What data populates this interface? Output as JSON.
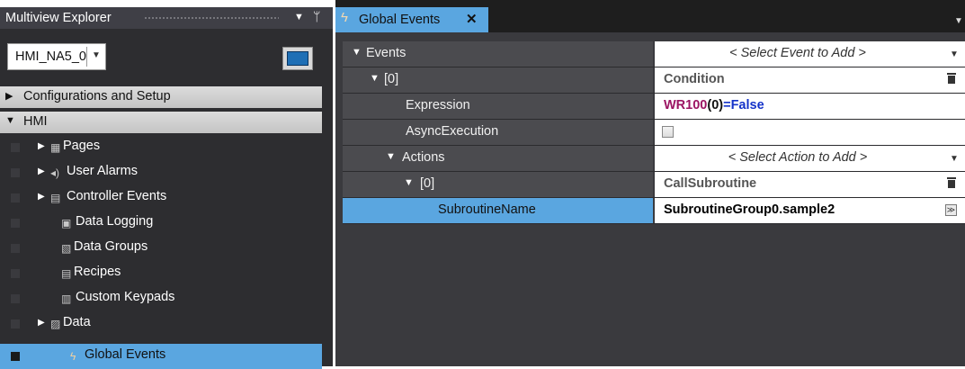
{
  "top_fragment": "ltiview Ex",
  "left_panel": {
    "title": "Multiview Explorer",
    "device": {
      "name": "HMI_NA5_0"
    },
    "sections": [
      {
        "label": "Configurations and Setup",
        "expanded": false
      },
      {
        "label": "HMI",
        "expanded": true
      }
    ],
    "items": [
      {
        "label": "Pages",
        "icon": "pages-icon",
        "expandable": true
      },
      {
        "label": "User Alarms",
        "icon": "alarm-speaker-icon",
        "expandable": true
      },
      {
        "label": "Controller Events",
        "icon": "controller-events-icon",
        "expandable": true
      },
      {
        "label": "Data Logging",
        "icon": "data-logging-icon",
        "expandable": false
      },
      {
        "label": "Data Groups",
        "icon": "data-groups-icon",
        "expandable": false
      },
      {
        "label": "Recipes",
        "icon": "recipes-icon",
        "expandable": false
      },
      {
        "label": "Custom Keypads",
        "icon": "keypad-icon",
        "expandable": false
      },
      {
        "label": "Data",
        "icon": "data-icon",
        "expandable": true
      },
      {
        "label": "Global Events",
        "icon": "lightning-icon",
        "expandable": false,
        "selected": true
      }
    ]
  },
  "editor": {
    "tab": {
      "label": "Global Events",
      "close": "✕"
    },
    "rows": {
      "events": {
        "label": "Events",
        "value": "< Select Event to Add >"
      },
      "event0": {
        "label": "[0]",
        "value": "Condition"
      },
      "expression": {
        "label": "Expression",
        "value_parts": {
          "a": "WR100",
          "b": "(0)",
          "c": "=",
          "d": "False"
        }
      },
      "async": {
        "label": "AsyncExecution",
        "checked": false
      },
      "actions": {
        "label": "Actions",
        "value": "< Select Action to Add >"
      },
      "action0": {
        "label": "[0]",
        "value": "CallSubroutine"
      },
      "subroutine": {
        "label": "SubroutineName",
        "value": "SubroutineGroup0.sample2"
      }
    }
  },
  "colors": {
    "accent": "#5aa6e0",
    "panel_dark": "#2d2d30",
    "editor_bg": "#3a3a3e",
    "expr_variable": "#9b1462",
    "expr_literal": "#1533c9"
  }
}
